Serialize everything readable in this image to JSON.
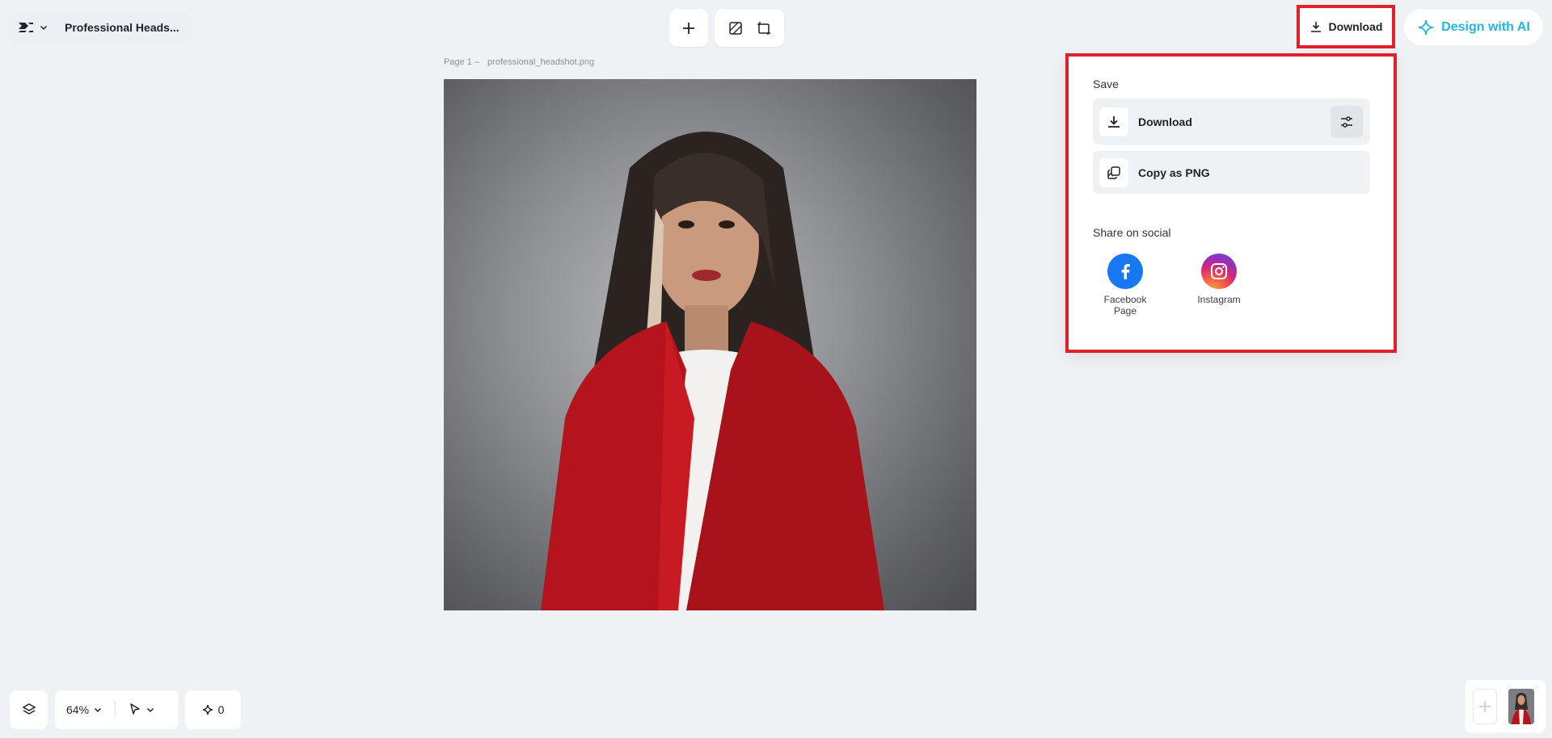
{
  "header": {
    "doc_title": "Professional Heads...",
    "download_label": "Download",
    "design_ai_label": "Design with AI"
  },
  "canvas": {
    "page_prefix": "Page 1 –",
    "file_name": "professional_headshot.png"
  },
  "download_panel": {
    "save_label": "Save",
    "download_label": "Download",
    "copy_png_label": "Copy as PNG",
    "share_label": "Share on social",
    "facebook_label": "Facebook Page",
    "instagram_label": "Instagram"
  },
  "bottom": {
    "zoom": "64%",
    "credits": "0"
  },
  "colors": {
    "accent": "#1fb6e6",
    "highlight": "#e1202b",
    "facebook": "#1877f2"
  }
}
